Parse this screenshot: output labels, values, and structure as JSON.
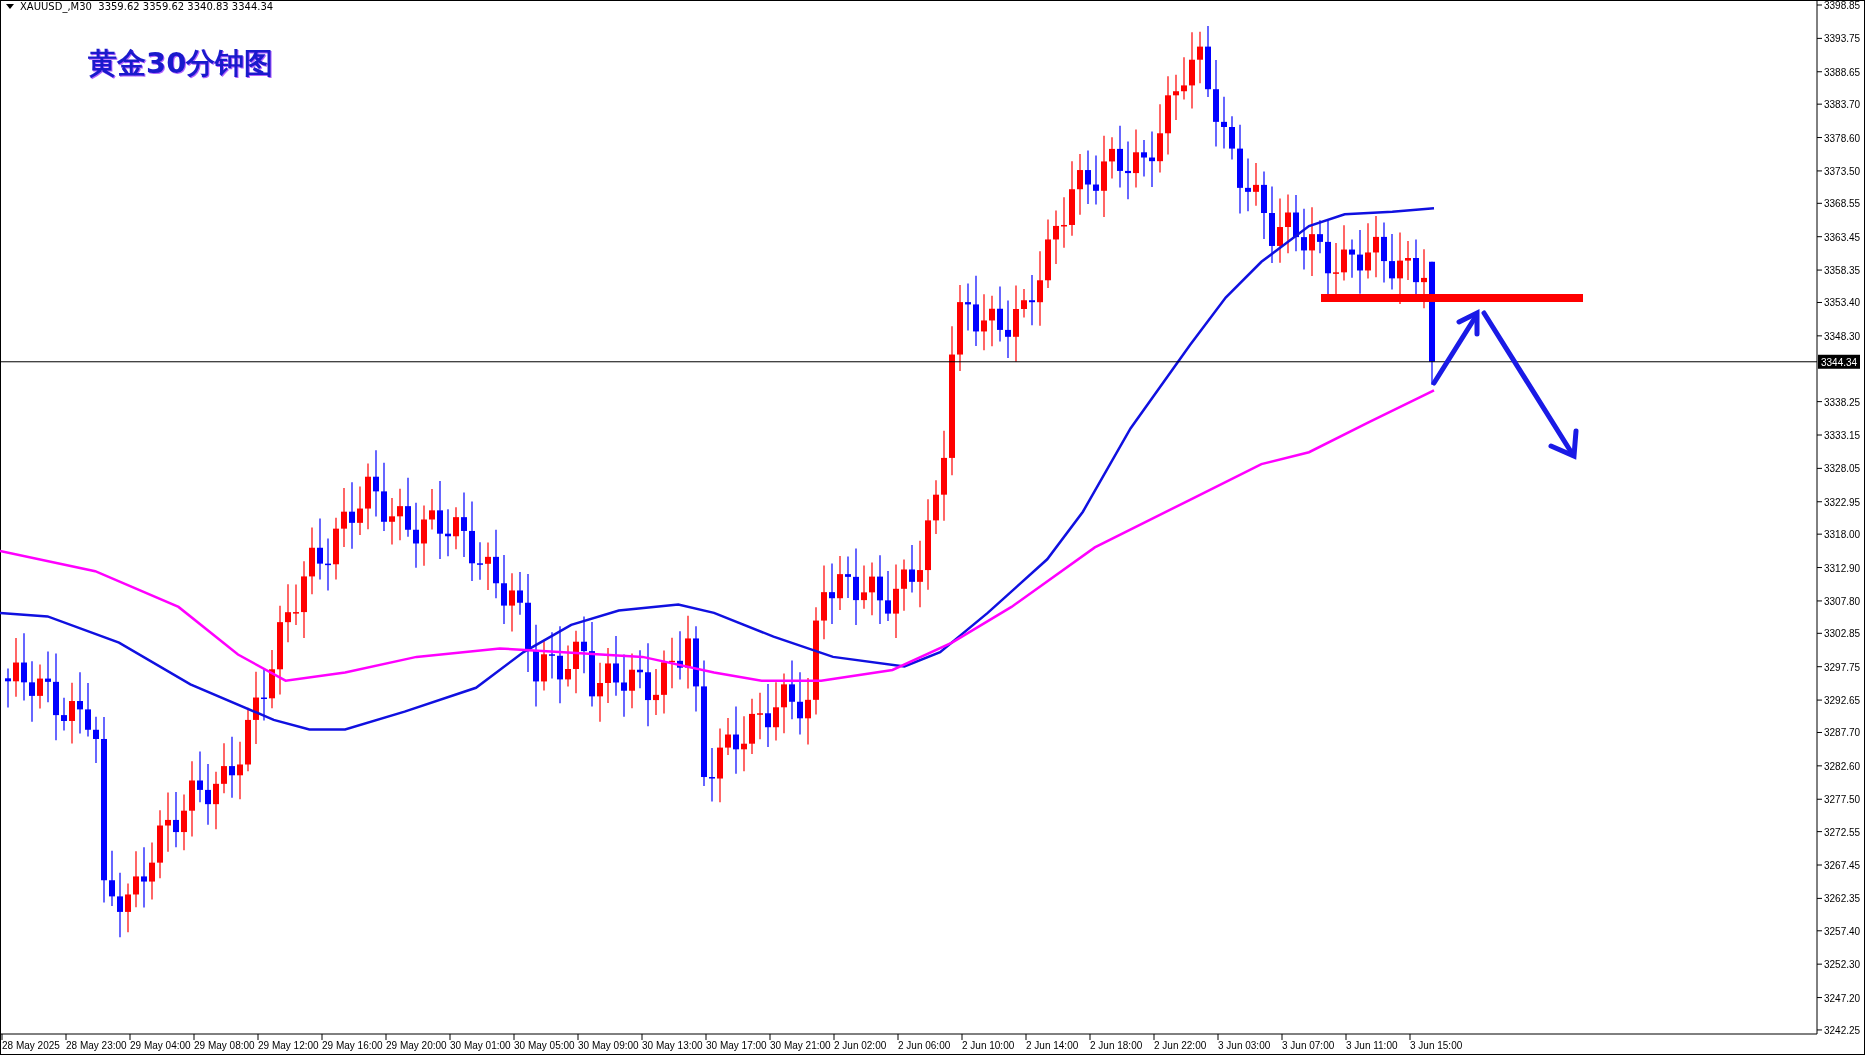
{
  "header": "XAUUSD_,M30  3359.62 3359.62 3340.83 3344.34",
  "title": "黄金30分钟图",
  "price_label": "3344.34",
  "price_axis": [
    "3398.85",
    "3393.75",
    "3388.65",
    "3383.70",
    "3378.60",
    "3373.50",
    "3368.55",
    "3363.45",
    "3358.35",
    "3353.40",
    "3348.30",
    "3338.25",
    "3333.15",
    "3328.05",
    "3322.95",
    "3318.00",
    "3312.90",
    "3307.80",
    "3302.85",
    "3297.75",
    "3292.65",
    "3287.70",
    "3282.60",
    "3277.50",
    "3272.55",
    "3267.45",
    "3262.35",
    "3257.40",
    "3252.30",
    "3247.20",
    "3242.25"
  ],
  "time_axis": [
    "28 May 2025",
    "28 May 23:00",
    "29 May 04:00",
    "29 May 08:00",
    "29 May 12:00",
    "29 May 16:00",
    "29 May 20:00",
    "30 May 01:00",
    "30 May 05:00",
    "30 May 09:00",
    "30 May 13:00",
    "30 May 17:00",
    "30 May 21:00",
    "2 Jun 02:00",
    "2 Jun 06:00",
    "2 Jun 10:00",
    "2 Jun 14:00",
    "2 Jun 18:00",
    "2 Jun 22:00",
    "3 Jun 03:00",
    "3 Jun 07:00",
    "3 Jun 11:00",
    "3 Jun 15:00"
  ]
}
